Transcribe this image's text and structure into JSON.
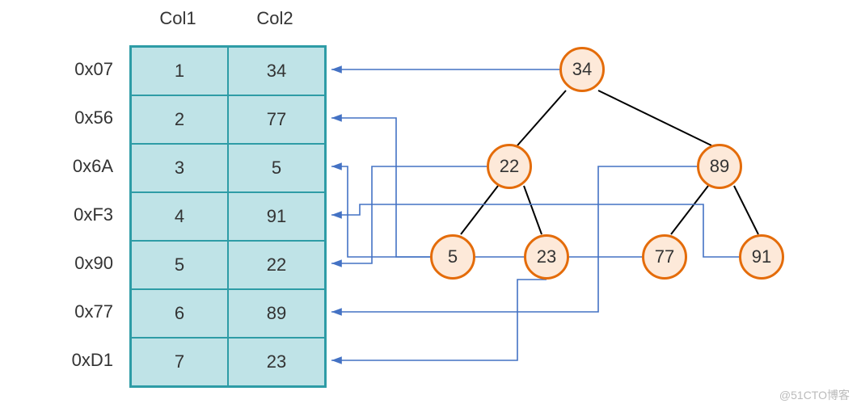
{
  "headers": {
    "col1": "Col1",
    "col2": "Col2"
  },
  "rows": [
    {
      "addr": "0x07",
      "col1": "1",
      "col2": "34"
    },
    {
      "addr": "0x56",
      "col1": "2",
      "col2": "77"
    },
    {
      "addr": "0x6A",
      "col1": "3",
      "col2": "5"
    },
    {
      "addr": "0xF3",
      "col1": "4",
      "col2": "91"
    },
    {
      "addr": "0x90",
      "col1": "5",
      "col2": "22"
    },
    {
      "addr": "0x77",
      "col1": "6",
      "col2": "89"
    },
    {
      "addr": "0xD1",
      "col1": "7",
      "col2": "23"
    }
  ],
  "tree": {
    "root": {
      "value": "34"
    },
    "l": {
      "value": "22"
    },
    "r": {
      "value": "89"
    },
    "ll": {
      "value": "5"
    },
    "lr": {
      "value": "23"
    },
    "rl": {
      "value": "77"
    },
    "rr": {
      "value": "91"
    }
  },
  "watermark": "@51CTO博客",
  "chart_data": {
    "type": "table",
    "description": "Diagram showing a table of rows (address, Col1, Col2) and a binary search tree built on Col2 values, with arrows from each tree node back to the matching table row.",
    "table": {
      "columns": [
        "address",
        "Col1",
        "Col2"
      ],
      "rows": [
        [
          "0x07",
          1,
          34
        ],
        [
          "0x56",
          2,
          77
        ],
        [
          "0x6A",
          3,
          5
        ],
        [
          "0xF3",
          4,
          91
        ],
        [
          "0x90",
          5,
          22
        ],
        [
          "0x77",
          6,
          89
        ],
        [
          "0xD1",
          7,
          23
        ]
      ]
    },
    "bst": {
      "value": 34,
      "left": {
        "value": 22,
        "left": {
          "value": 5
        },
        "right": {
          "value": 23
        }
      },
      "right": {
        "value": 89,
        "left": {
          "value": 77
        },
        "right": {
          "value": 91
        }
      }
    },
    "node_to_row_links": [
      {
        "node": 34,
        "row_col2": 34
      },
      {
        "node": 22,
        "row_col2": 22
      },
      {
        "node": 89,
        "row_col2": 89
      },
      {
        "node": 5,
        "row_col2": 5
      },
      {
        "node": 23,
        "row_col2": 23
      },
      {
        "node": 77,
        "row_col2": 77
      },
      {
        "node": 91,
        "row_col2": 91
      }
    ]
  }
}
